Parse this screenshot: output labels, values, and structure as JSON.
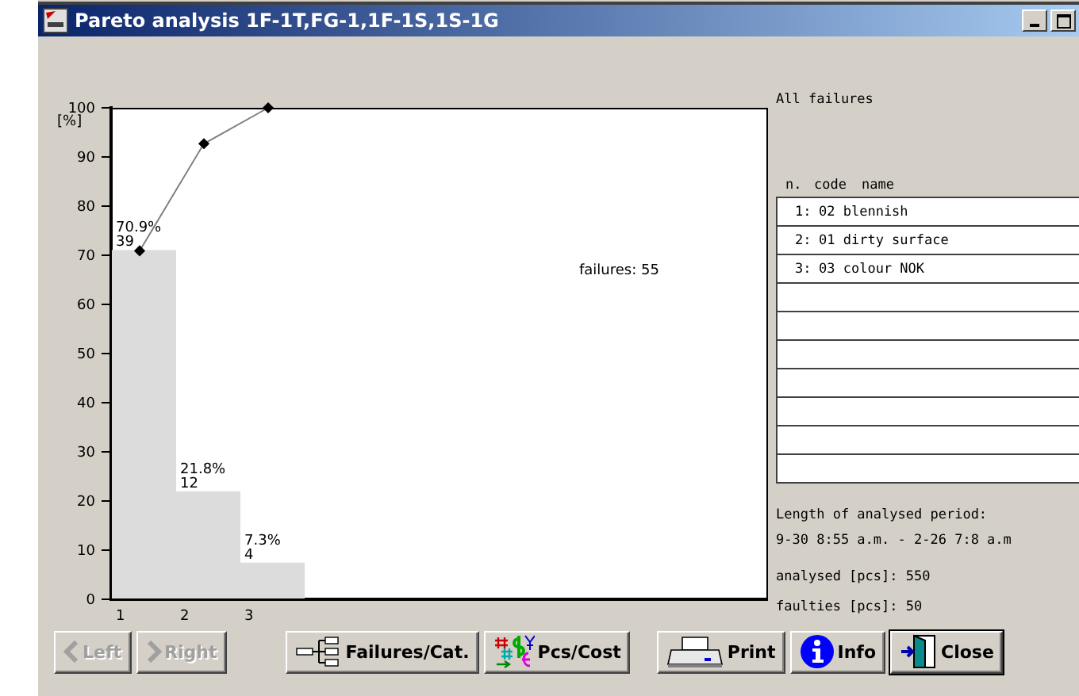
{
  "window": {
    "title": "Pareto analysis 1F-1T,FG-1,1F-1S,1S-1G"
  },
  "chart": {
    "note": "failures: 55",
    "bar_counts": [
      "39",
      "12",
      "4"
    ],
    "chart_data": {
      "type": "bar",
      "ylabel": "[%]",
      "categories": [
        "1",
        "2",
        "3"
      ],
      "ylim": [
        0,
        100
      ],
      "yticks": [
        0,
        10,
        20,
        30,
        40,
        50,
        60,
        70,
        80,
        90,
        100
      ],
      "series": [
        {
          "color": "#dcdcdc",
          "values": [
            70.9,
            21.8,
            7.3
          ]
        }
      ],
      "value_labels": [
        "70.9%",
        "21.8%",
        "7.3%"
      ]
    },
    "cumulative": {
      "chart_data": {
        "type": "line",
        "ylim": [
          0,
          100
        ],
        "series": [
          {
            "color": "#808080",
            "marker": "diamond",
            "values": [
              70.9,
              92.7,
              100
            ]
          }
        ]
      }
    }
  },
  "failures": {
    "title": "All failures",
    "columns": [
      "n.",
      "code",
      "name"
    ],
    "rows": [
      {
        "n": "1:",
        "name": "02 blennish"
      },
      {
        "n": "2:",
        "name": "01 dirty surface"
      },
      {
        "n": "3:",
        "name": "03 colour NOK"
      }
    ],
    "period_label": "Length of analysed period:",
    "period": "9-30 8:55 a.m. - 2-26 7:8 a.m",
    "analysed": "analysed [pcs]: 550",
    "faulties": "faulties [pcs]: 50"
  },
  "buttons": [
    {
      "kind": "left",
      "label": "Left",
      "disabled": true
    },
    {
      "kind": "right",
      "label": "Right",
      "disabled": true
    },
    {
      "kind": "failures",
      "label": "Failures/Cat.",
      "disabled": false
    },
    {
      "kind": "cost",
      "label": "Pcs/Cost",
      "disabled": false
    },
    {
      "kind": "print",
      "label": "Print",
      "disabled": false
    },
    {
      "kind": "info",
      "label": "Info",
      "disabled": false
    },
    {
      "kind": "close",
      "label": "Close",
      "disabled": false
    }
  ]
}
